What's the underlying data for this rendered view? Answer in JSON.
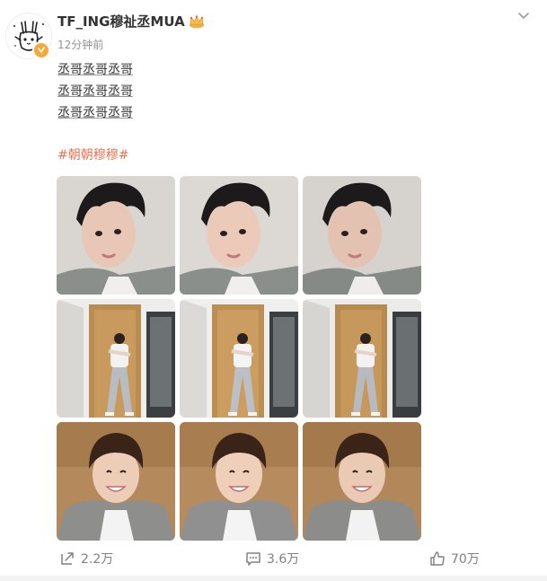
{
  "post": {
    "author": {
      "name": "TF_ING穆祉丞MUA",
      "avatar_icon": "doodle-avatar-icon",
      "badge_icon": "verified-badge-icon",
      "crown_icon": "crown-icon"
    },
    "timestamp": "12分钟前",
    "text_lines": [
      "丞哥丞哥丞哥",
      "丞哥丞哥丞哥",
      "丞哥丞哥丞哥"
    ],
    "hashtag": "#朝朝穆穆#",
    "photos": [
      {
        "scene": "selfie-closeup"
      },
      {
        "scene": "selfie-closeup"
      },
      {
        "scene": "selfie-closeup"
      },
      {
        "scene": "full-body-doorway"
      },
      {
        "scene": "full-body-doorway"
      },
      {
        "scene": "full-body-doorway"
      },
      {
        "scene": "smiling-selfie"
      },
      {
        "scene": "smiling-selfie"
      },
      {
        "scene": "smiling-selfie"
      }
    ]
  },
  "actions": {
    "repost_count": "2.2万",
    "comment_count": "3.6万",
    "like_count": "70万",
    "repost_icon": "repost-icon",
    "comment_icon": "comment-icon",
    "like_icon": "thumbs-up-icon"
  },
  "colors": {
    "hashtag": "#eb7350",
    "badge": "#f7a83b",
    "muted": "#939393"
  }
}
